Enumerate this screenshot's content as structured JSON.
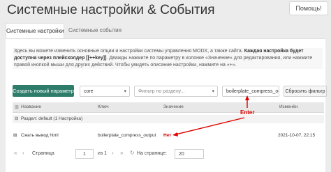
{
  "header": {
    "title": "Системные настройки & События",
    "help_label": "Помощь!"
  },
  "tabs": [
    {
      "label": "Системные настройки"
    },
    {
      "label": "Системные события"
    }
  ],
  "description": {
    "text": "Здесь вы можете изменить основные опции и настройки системы управления MODX, а также сайта. ",
    "bold1": "Каждая настройка будет доступна через плейсхолдер [[++key]]",
    "text2": ". Дважды нажмите по параметру в колонке «Значение» для редактирования, или нажмите правой кнопкой мыши для других действий. Чтобы увидеть описание настройки, нажмите на «+»."
  },
  "toolbar": {
    "create_label": "Создать новый параметр",
    "namespace_value": "core",
    "area_placeholder": "Фильтр по разделу...",
    "key_value": "boilerplate_compress_outp",
    "clear_label": "Сбросить фильтр"
  },
  "table": {
    "columns": [
      "Название",
      "Ключ",
      "Значение",
      "Изменён"
    ],
    "group_label": "Раздел: default (1 Настройка)",
    "rows": [
      {
        "name": "Сжать вывод html",
        "key": "boilerplate_compress_output",
        "value": "Нет",
        "modified": "2021-10-07, 22:15"
      }
    ]
  },
  "pager": {
    "page_label": "Страница",
    "page_value": "1",
    "of_label": "из 1",
    "per_page_label": "На странице:",
    "per_page_value": "20"
  },
  "annotation": {
    "text": "Enter",
    "color": "#dd0000"
  }
}
